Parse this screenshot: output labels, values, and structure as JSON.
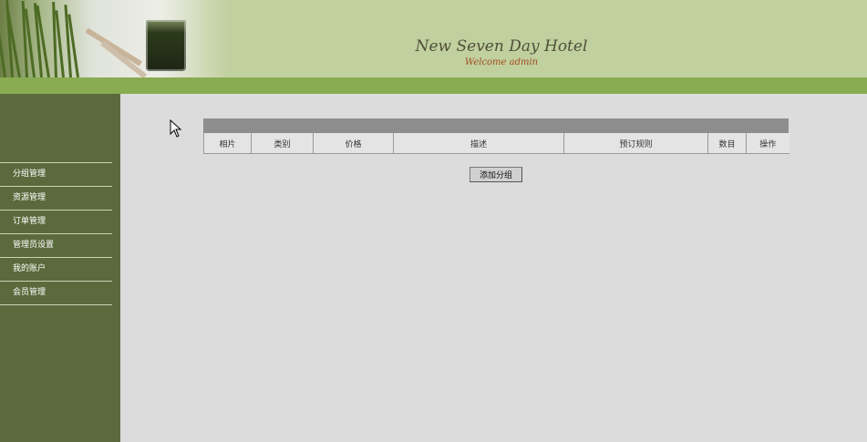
{
  "header": {
    "hotel_name": "New Seven Day Hotel",
    "welcome": "Welcome admin"
  },
  "sidebar": {
    "items": [
      {
        "label": "分组管理"
      },
      {
        "label": "资源管理"
      },
      {
        "label": "订单管理"
      },
      {
        "label": "管理员设置"
      },
      {
        "label": "我的账户"
      },
      {
        "label": "会员管理"
      }
    ]
  },
  "table": {
    "columns": [
      "相片",
      "类别",
      "价格",
      "描述",
      "预订规则",
      "数目",
      "操作"
    ]
  },
  "actions": {
    "add_group": "添加分组"
  },
  "colors": {
    "header_bg": "#c0d09e",
    "band": "#89ab52",
    "sidebar_bg": "#5b6a3c",
    "content_bg": "#dcdcdc"
  }
}
